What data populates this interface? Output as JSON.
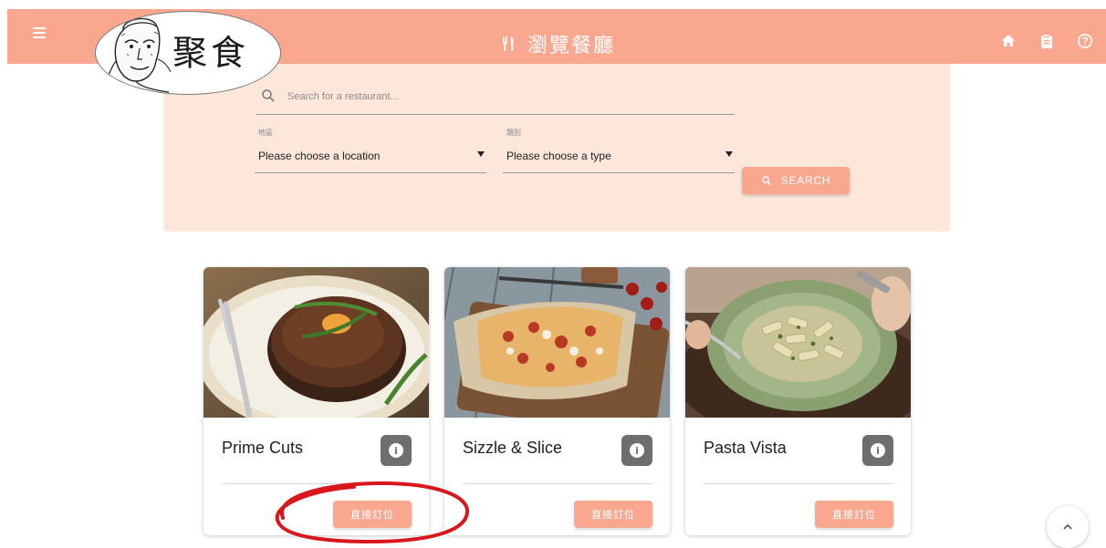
{
  "header": {
    "logo_text": "聚食",
    "title": "瀏覽餐廳",
    "icons": [
      "menu-icon",
      "restaurant-icon",
      "home-icon",
      "clipboard-icon",
      "help-icon"
    ]
  },
  "search": {
    "placeholder": "Search for a restaurant...",
    "location_label": "地區",
    "location_value": "Please choose a location",
    "type_label": "類別",
    "type_value": "Please choose a type",
    "button_label": "SEARCH"
  },
  "restaurants": [
    {
      "name": "Prime Cuts",
      "book_label": "直接訂位",
      "image": "steak-photo"
    },
    {
      "name": "Sizzle & Slice",
      "book_label": "直接訂位",
      "image": "pizza-photo"
    },
    {
      "name": "Pasta Vista",
      "book_label": "直接訂位",
      "image": "pasta-photo"
    }
  ],
  "colors": {
    "accent": "#f9a88f",
    "panel": "#fde6da",
    "info_button": "#6e6e6e",
    "annotation": "#d9161b"
  }
}
